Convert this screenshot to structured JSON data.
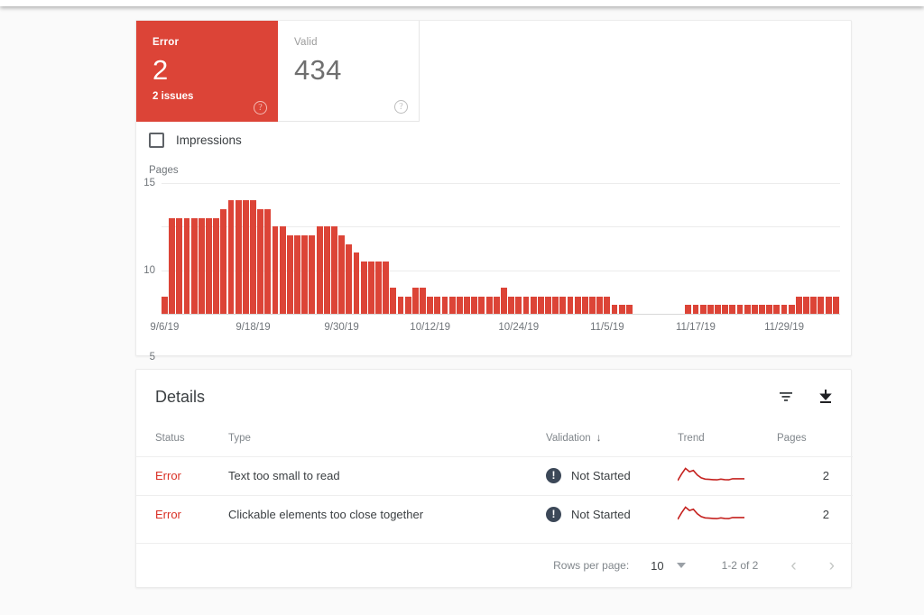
{
  "summary": {
    "cards": [
      {
        "label": "Error",
        "value": "2",
        "sub": "2 issues",
        "help": "help-icon",
        "state": "error"
      },
      {
        "label": "Valid",
        "value": "434",
        "sub": "",
        "help": "help-icon",
        "state": "valid"
      }
    ]
  },
  "impressions": {
    "label": "Impressions",
    "checked": false
  },
  "details": {
    "title": "Details",
    "filter_icon": "filter-icon",
    "download_icon": "download-icon",
    "columns": [
      "Status",
      "Type",
      "Validation",
      "Trend",
      "Pages"
    ],
    "sort_column": "Validation",
    "sort_arrow": "↓",
    "rows": [
      {
        "status": "Error",
        "type": "Text too small to read",
        "validation": "Not Started",
        "validation_icon": "exclamation-circle-icon",
        "pages": "2"
      },
      {
        "status": "Error",
        "type": "Clickable elements too close together",
        "validation": "Not Started",
        "validation_icon": "exclamation-circle-icon",
        "pages": "2"
      }
    ],
    "pagination": {
      "rows_per_page_label": "Rows per page:",
      "rows_per_page_value": "10",
      "range": "1-2 of 2",
      "prev": "‹",
      "next": "›"
    }
  },
  "colors": {
    "error_red": "#DC4437",
    "bar_red": "#DC4437",
    "status_red": "#d93025",
    "icon_slate": "#3c4858",
    "grid": "#ececec"
  },
  "chart_data": {
    "type": "bar",
    "title": "",
    "ylabel": "Pages",
    "xlabel": "",
    "ylim": [
      0,
      15
    ],
    "yticks": [
      0,
      5,
      10,
      15
    ],
    "grid": true,
    "legend": false,
    "tick_labels": [
      "9/6/19",
      "9/18/19",
      "9/30/19",
      "10/12/19",
      "10/24/19",
      "11/5/19",
      "11/17/19",
      "11/29/19"
    ],
    "tick_indices": [
      0,
      12,
      24,
      36,
      48,
      60,
      72,
      84
    ],
    "x": [
      "9/6/19",
      "9/7/19",
      "9/8/19",
      "9/9/19",
      "9/10/19",
      "9/11/19",
      "9/12/19",
      "9/13/19",
      "9/14/19",
      "9/15/19",
      "9/16/19",
      "9/17/19",
      "9/18/19",
      "9/19/19",
      "9/20/19",
      "9/21/19",
      "9/22/19",
      "9/23/19",
      "9/24/19",
      "9/25/19",
      "9/26/19",
      "9/27/19",
      "9/28/19",
      "9/29/19",
      "9/30/19",
      "10/1/19",
      "10/2/19",
      "10/3/19",
      "10/4/19",
      "10/5/19",
      "10/6/19",
      "10/7/19",
      "10/8/19",
      "10/9/19",
      "10/10/19",
      "10/11/19",
      "10/12/19",
      "10/13/19",
      "10/14/19",
      "10/15/19",
      "10/16/19",
      "10/17/19",
      "10/18/19",
      "10/19/19",
      "10/20/19",
      "10/21/19",
      "10/22/19",
      "10/23/19",
      "10/24/19",
      "10/25/19",
      "10/26/19",
      "10/27/19",
      "10/28/19",
      "10/29/19",
      "10/30/19",
      "10/31/19",
      "11/1/19",
      "11/2/19",
      "11/3/19",
      "11/4/19",
      "11/5/19",
      "11/6/19",
      "11/7/19",
      "11/8/19",
      "11/9/19",
      "11/10/19",
      "11/11/19",
      "11/12/19",
      "11/13/19",
      "11/14/19",
      "11/15/19",
      "11/16/19",
      "11/17/19",
      "11/18/19",
      "11/19/19",
      "11/20/19",
      "11/21/19",
      "11/22/19",
      "11/23/19",
      "11/24/19",
      "11/25/19",
      "11/26/19",
      "11/27/19",
      "11/28/19",
      "11/29/19",
      "11/30/19",
      "12/1/19",
      "12/2/19",
      "12/3/19",
      "12/4/19",
      "12/5/19"
    ],
    "values": [
      2,
      11,
      11,
      11,
      11,
      11,
      11,
      11,
      12,
      13,
      13,
      13,
      13,
      12,
      12,
      10,
      10,
      9,
      9,
      9,
      9,
      10,
      10,
      10,
      9,
      8,
      7,
      6,
      6,
      6,
      6,
      3,
      2,
      2,
      3,
      3,
      2,
      2,
      2,
      2,
      2,
      2,
      2,
      2,
      2,
      2,
      3,
      2,
      2,
      2,
      2,
      2,
      2,
      2,
      2,
      2,
      2,
      2,
      2,
      2,
      2,
      1,
      1,
      1,
      0,
      0,
      0,
      0,
      0,
      0,
      0,
      1,
      1,
      1,
      1,
      1,
      1,
      1,
      1,
      1,
      1,
      1,
      1,
      1,
      1,
      1,
      2,
      2,
      2,
      2,
      2,
      2
    ],
    "series_name": "Pages"
  },
  "trend_sparkline": {
    "color": "#c5221f",
    "points": [
      0.12,
      0.55,
      0.92,
      0.7,
      0.78,
      0.48,
      0.3,
      0.22,
      0.2,
      0.18,
      0.17,
      0.22,
      0.18,
      0.17,
      0.24,
      0.24,
      0.24,
      0.24
    ]
  }
}
